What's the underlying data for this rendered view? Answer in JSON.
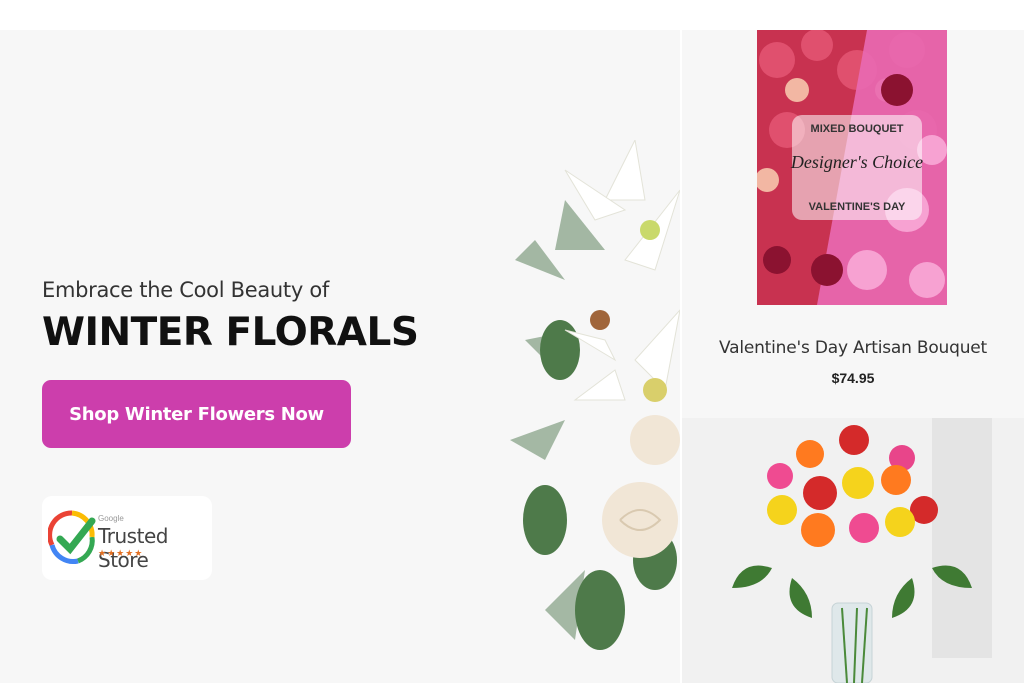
{
  "hero": {
    "tagline": "Embrace the Cool Beauty of",
    "headline": "WINTER FLORALS",
    "cta_label": "Shop Winter Flowers Now",
    "badge": {
      "small_text": "Google",
      "title": "Trusted Store",
      "stars": "★★★★★"
    }
  },
  "products": [
    {
      "image_text": {
        "line1": "MIXED BOUQUET",
        "line2": "Designer's Choice",
        "line3": "VALENTINE'S DAY"
      },
      "name": "Valentine's Day Artisan Bouquet",
      "price": "$74.95"
    }
  ],
  "colors": {
    "cta": "#cc3eac",
    "hero_bg": "#f7f7f7",
    "star": "#e36f21"
  }
}
